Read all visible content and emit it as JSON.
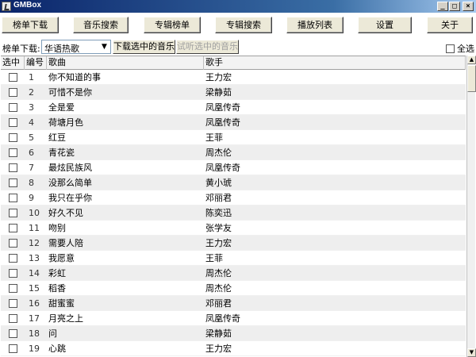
{
  "window": {
    "title": "GMBox"
  },
  "window_buttons": {
    "minimize": "_",
    "maximize": "□",
    "close": "×"
  },
  "toolbar": {
    "buttons": [
      "榜单下载",
      "音乐搜索",
      "专辑榜单",
      "专辑搜索",
      "播放列表",
      "设置",
      "关于"
    ]
  },
  "filter": {
    "label": "榜单下载:",
    "selected": "华语热歌",
    "download_button": "下载选中的音乐",
    "preview_button": "试听选中的音乐",
    "select_all": "全选"
  },
  "table": {
    "headers": [
      "选中",
      "编号",
      "歌曲",
      "歌手"
    ],
    "rows": [
      {
        "num": "1",
        "song": "你不知道的事",
        "artist": "王力宏"
      },
      {
        "num": "2",
        "song": "可惜不是你",
        "artist": "梁静茹"
      },
      {
        "num": "3",
        "song": "全是爱",
        "artist": "凤凰传奇"
      },
      {
        "num": "4",
        "song": "荷塘月色",
        "artist": "凤凰传奇"
      },
      {
        "num": "5",
        "song": "红豆",
        "artist": "王菲"
      },
      {
        "num": "6",
        "song": "青花瓷",
        "artist": "周杰伦"
      },
      {
        "num": "7",
        "song": "最炫民族风",
        "artist": "凤凰传奇"
      },
      {
        "num": "8",
        "song": "没那么简单",
        "artist": "黄小琥"
      },
      {
        "num": "9",
        "song": "我只在乎你",
        "artist": "邓丽君"
      },
      {
        "num": "10",
        "song": "好久不见",
        "artist": "陈奕迅"
      },
      {
        "num": "11",
        "song": "吻别",
        "artist": "张学友"
      },
      {
        "num": "12",
        "song": "需要人陪",
        "artist": "王力宏"
      },
      {
        "num": "13",
        "song": "我愿意",
        "artist": "王菲"
      },
      {
        "num": "14",
        "song": "彩虹",
        "artist": "周杰伦"
      },
      {
        "num": "15",
        "song": "稻香",
        "artist": "周杰伦"
      },
      {
        "num": "16",
        "song": "甜蜜蜜",
        "artist": "邓丽君"
      },
      {
        "num": "17",
        "song": "月亮之上",
        "artist": "凤凰传奇"
      },
      {
        "num": "18",
        "song": "问",
        "artist": "梁静茹"
      },
      {
        "num": "19",
        "song": "心跳",
        "artist": "王力宏"
      }
    ]
  }
}
